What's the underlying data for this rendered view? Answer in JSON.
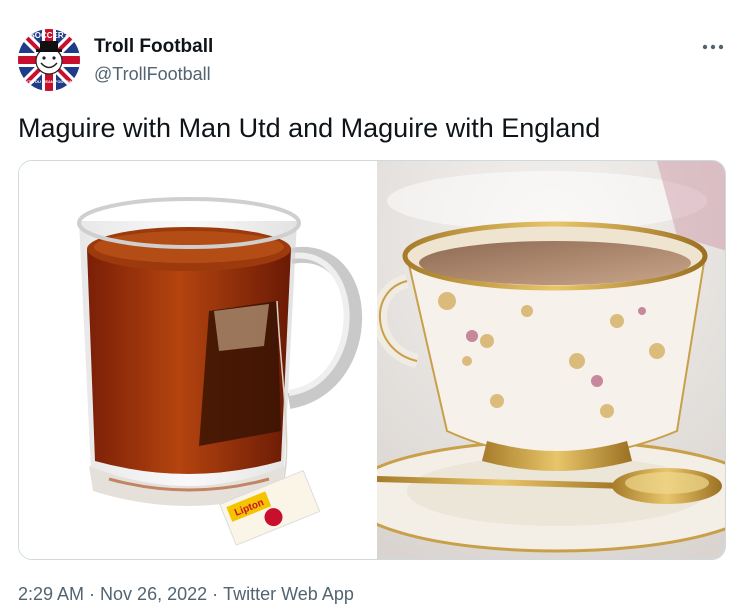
{
  "author": {
    "display_name": "Troll Football",
    "handle": "@TrollFootball",
    "avatar_top_text": "SOCCER?",
    "avatar_bottom_text": "DON'T YOU MEAN FOOTBALL?"
  },
  "tweet": {
    "text": "Maguire with Man Utd and Maguire with England"
  },
  "media": {
    "left_image": "tea-mug-with-teabag",
    "right_image": "floral-teacup-with-milk-tea",
    "left_tag_text": "Lipton"
  },
  "meta": {
    "time": "2:29 AM",
    "separator": "·",
    "date": "Nov 26, 2022",
    "source": "Twitter Web App"
  },
  "colors": {
    "text": "#0f1419",
    "secondary": "#536471",
    "border": "#cfd9de"
  }
}
